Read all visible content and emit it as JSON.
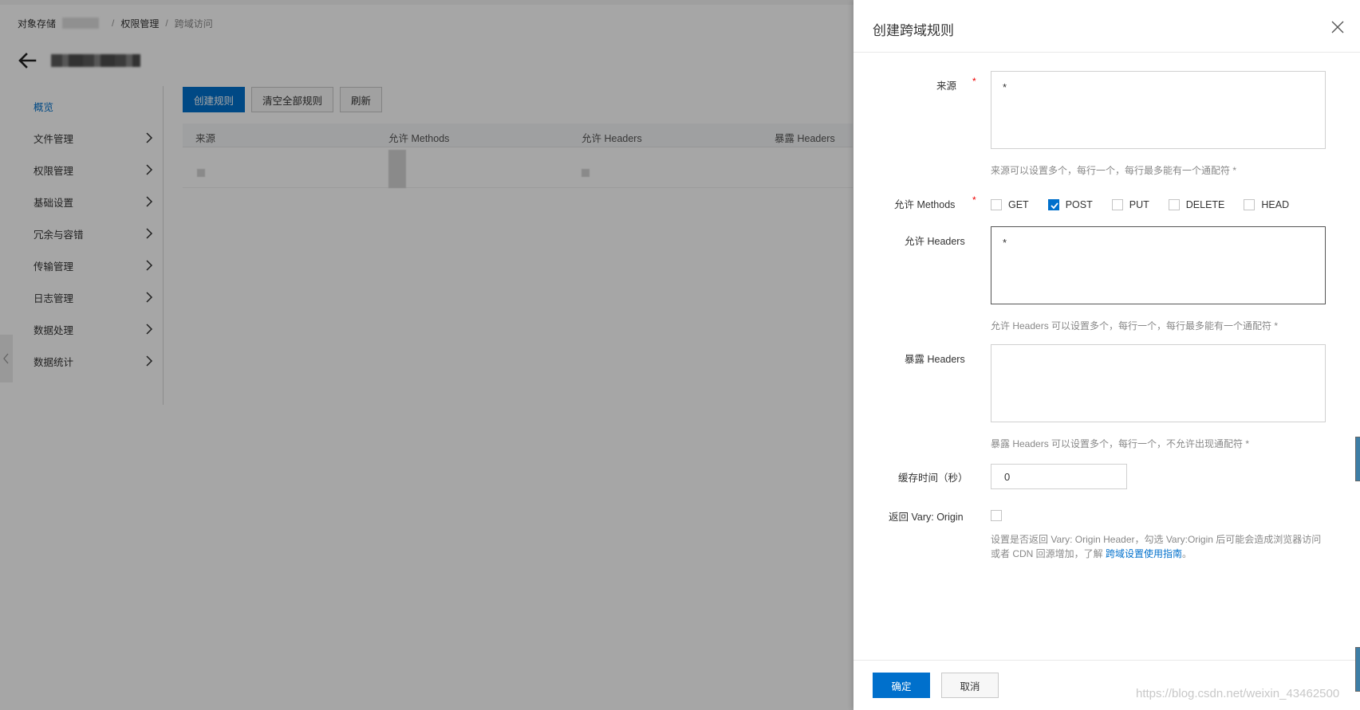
{
  "breadcrumb": {
    "root": "对象存储",
    "section": "权限管理",
    "current": "跨域访问",
    "separator": "/"
  },
  "sidebar": {
    "items": [
      {
        "label": "概览"
      },
      {
        "label": "文件管理"
      },
      {
        "label": "权限管理"
      },
      {
        "label": "基础设置"
      },
      {
        "label": "冗余与容错"
      },
      {
        "label": "传输管理"
      },
      {
        "label": "日志管理"
      },
      {
        "label": "数据处理"
      },
      {
        "label": "数据统计"
      }
    ]
  },
  "toolbar": {
    "create": "创建规则",
    "clear_all": "清空全部规则",
    "refresh": "刷新"
  },
  "table": {
    "columns": [
      "来源",
      "允许 Methods",
      "允许 Headers",
      "暴露 Headers"
    ]
  },
  "drawer": {
    "title": "创建跨域规则",
    "origin": {
      "label": "来源",
      "required_mark": "*",
      "value": "*",
      "hint": "来源可以设置多个，每行一个，每行最多能有一个通配符 *"
    },
    "methods": {
      "label": "允许 Methods",
      "required_mark": "*",
      "options": [
        {
          "label": "GET",
          "checked": false
        },
        {
          "label": "POST",
          "checked": true
        },
        {
          "label": "PUT",
          "checked": false
        },
        {
          "label": "DELETE",
          "checked": false
        },
        {
          "label": "HEAD",
          "checked": false
        }
      ]
    },
    "allow_headers": {
      "label": "允许 Headers",
      "value": "*",
      "hint": "允许 Headers 可以设置多个，每行一个，每行最多能有一个通配符 *"
    },
    "expose_headers": {
      "label": "暴露 Headers",
      "value": "",
      "hint": "暴露 Headers 可以设置多个，每行一个，不允许出现通配符 *"
    },
    "cache": {
      "label": "缓存时间（秒）",
      "value": "0"
    },
    "vary": {
      "label": "返回 Vary: Origin",
      "checked": false,
      "hint": "设置是否返回 Vary: Origin Header，勾选 Vary:Origin 后可能会造成浏览器访问或者 CDN 回源增加，了解 ",
      "link": "跨域设置使用指南",
      "hint_end": "。"
    },
    "confirm": "确定",
    "cancel": "取消",
    "watermark": "https://blog.csdn.net/weixin_43462500"
  },
  "colors": {
    "primary": "#0070cc",
    "required": "#e00000"
  }
}
